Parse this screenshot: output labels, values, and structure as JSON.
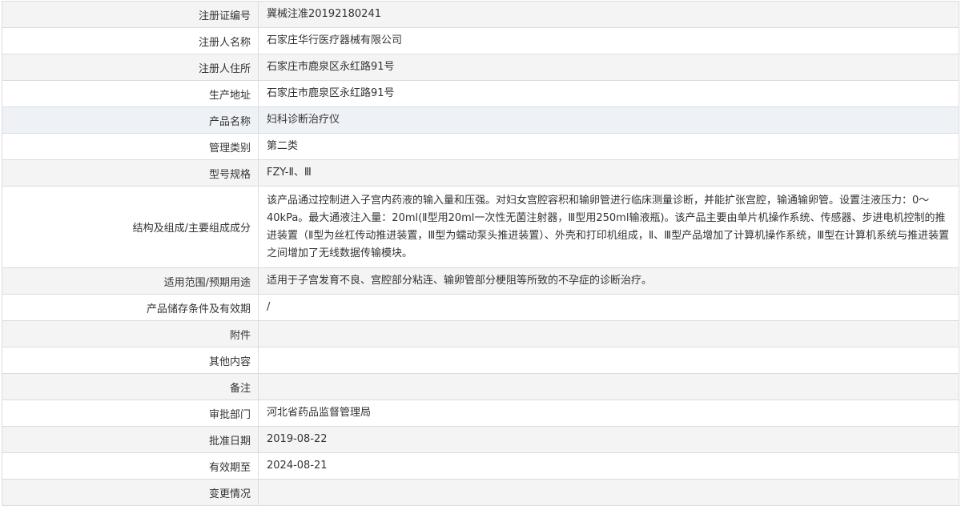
{
  "rows": [
    {
      "label": "注册证编号",
      "value": "冀械注准20192180241"
    },
    {
      "label": "注册人名称",
      "value": "石家庄华行医疗器械有限公司"
    },
    {
      "label": "注册人住所",
      "value": "石家庄市鹿泉区永红路91号"
    },
    {
      "label": "生产地址",
      "value": "石家庄市鹿泉区永红路91号"
    },
    {
      "label": "产品名称",
      "value": "妇科诊断治疗仪"
    },
    {
      "label": "管理类别",
      "value": "第二类"
    },
    {
      "label": "型号规格",
      "value": "FZY-Ⅱ、Ⅲ"
    },
    {
      "label": "结构及组成/主要组成成分",
      "value": "该产品通过控制进入子宫内药液的输入量和压强。对妇女宫腔容积和输卵管进行临床测量诊断，并能扩张宫腔，输通输卵管。设置注液压力：0～40kPa。最大通液注入量：20ml(Ⅱ型用20ml一次性无菌注射器，Ⅲ型用250ml输液瓶)。该产品主要由单片机操作系统、传感器、步进电机控制的推进装置（Ⅱ型为丝杠传动推进装置，Ⅲ型为蠕动泵头推进装置）、外壳和打印机组成，Ⅱ、Ⅲ型产品增加了计算机操作系统，Ⅲ型在计算机系统与推进装置之间增加了无线数据传输模块。"
    },
    {
      "label": "适用范围/预期用途",
      "value": "适用于子宫发育不良、宫腔部分粘连、输卵管部分梗阻等所致的不孕症的诊断治疗。"
    },
    {
      "label": "产品储存条件及有效期",
      "value": "/"
    },
    {
      "label": "附件",
      "value": ""
    },
    {
      "label": "其他内容",
      "value": ""
    },
    {
      "label": "备注",
      "value": ""
    },
    {
      "label": "审批部门",
      "value": "河北省药品监督管理局"
    },
    {
      "label": "批准日期",
      "value": "2019-08-22"
    },
    {
      "label": "有效期至",
      "value": "2024-08-21"
    },
    {
      "label": "变更情况",
      "value": ""
    }
  ]
}
